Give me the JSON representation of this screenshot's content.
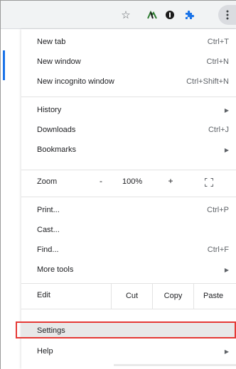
{
  "toolbar": {
    "star_icon": "star-icon",
    "extension_icons": [
      "ext-a-icon",
      "ext-b-icon",
      "puzzle-icon"
    ],
    "menu_icon": "kebab-icon",
    "puzzle_color": "#1a73e8"
  },
  "menu": {
    "new_tab": {
      "label": "New tab",
      "shortcut": "Ctrl+T"
    },
    "new_window": {
      "label": "New window",
      "shortcut": "Ctrl+N"
    },
    "new_incognito": {
      "label": "New incognito window",
      "shortcut": "Ctrl+Shift+N"
    },
    "history": {
      "label": "History"
    },
    "downloads": {
      "label": "Downloads",
      "shortcut": "Ctrl+J"
    },
    "bookmarks": {
      "label": "Bookmarks"
    },
    "zoom": {
      "label": "Zoom",
      "minus": "-",
      "value": "100%",
      "plus": "+"
    },
    "print": {
      "label": "Print...",
      "shortcut": "Ctrl+P"
    },
    "cast": {
      "label": "Cast..."
    },
    "find": {
      "label": "Find...",
      "shortcut": "Ctrl+F"
    },
    "more_tools": {
      "label": "More tools"
    },
    "edit": {
      "label": "Edit",
      "cut": "Cut",
      "copy": "Copy",
      "paste": "Paste"
    },
    "settings": {
      "label": "Settings"
    },
    "help": {
      "label": "Help"
    }
  },
  "highlight_color": "#e53935",
  "accent_color": "#1a73e8"
}
